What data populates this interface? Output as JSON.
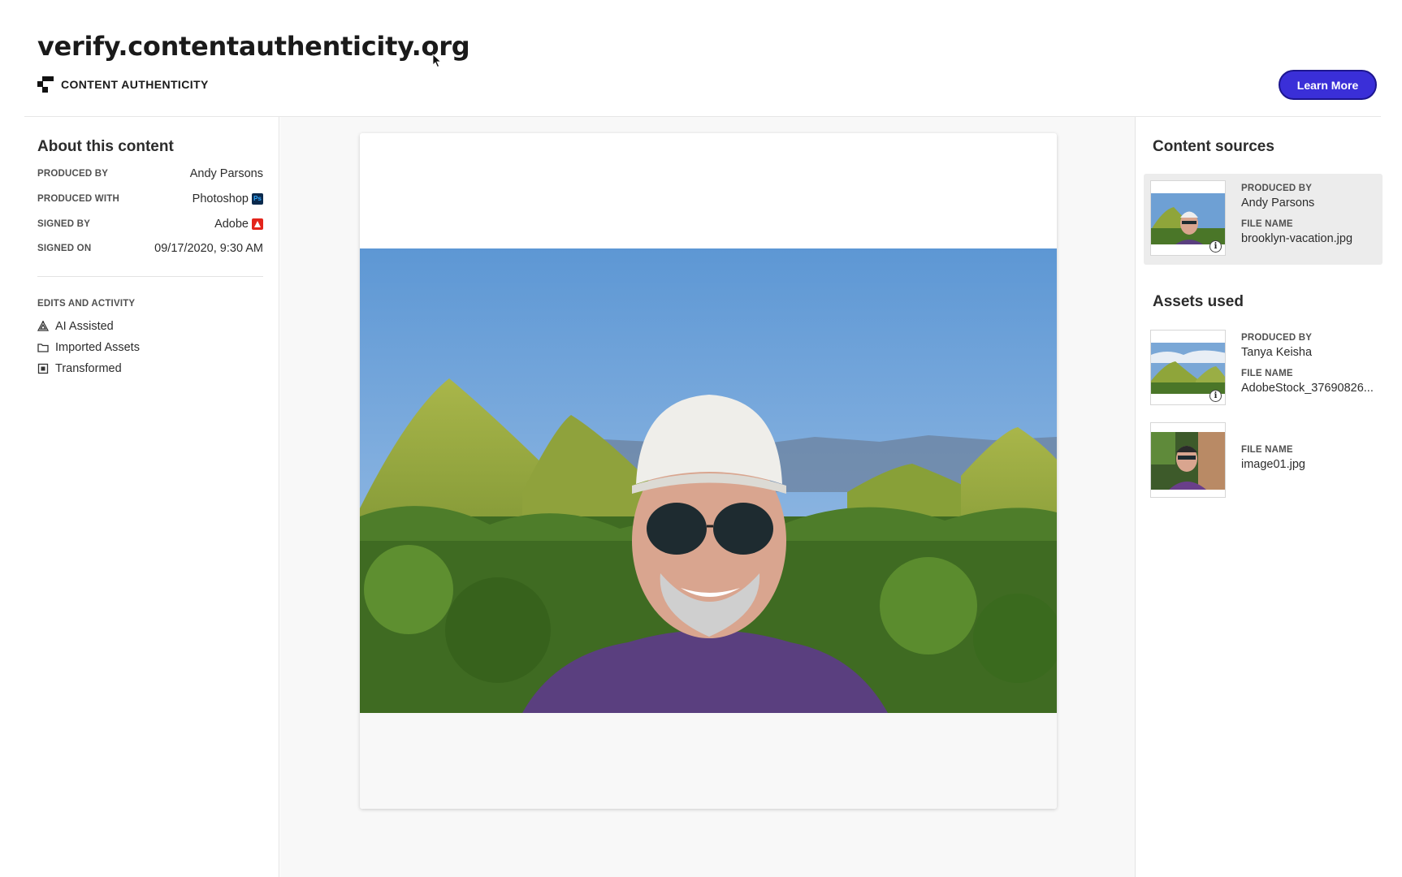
{
  "header": {
    "url": "verify.contentauthenticity.org",
    "brand": "CONTENT AUTHENTICITY",
    "learn_more": "Learn More"
  },
  "about": {
    "title": "About this content",
    "rows": [
      {
        "key": "PRODUCED BY",
        "value": "Andy Parsons"
      },
      {
        "key": "PRODUCED WITH",
        "value": "Photoshop",
        "badge": "Ps"
      },
      {
        "key": "SIGNED BY",
        "value": "Adobe"
      },
      {
        "key": "SIGNED ON",
        "value": "09/17/2020, 9:30 AM"
      }
    ],
    "edits_title": "EDITS AND ACTIVITY",
    "edits": [
      "AI Assisted",
      "Imported Assets",
      "Transformed"
    ]
  },
  "sources": {
    "title": "Content sources",
    "items": [
      {
        "produced_by_label": "PRODUCED BY",
        "produced_by": "Andy Parsons",
        "file_label": "FILE NAME",
        "file": "brooklyn-vacation.jpg"
      }
    ]
  },
  "assets": {
    "title": "Assets used",
    "items": [
      {
        "produced_by_label": "PRODUCED BY",
        "produced_by": "Tanya Keisha",
        "file_label": "FILE NAME",
        "file": "AdobeStock_37690826..."
      },
      {
        "file_label": "FILE NAME",
        "file": "image01.jpg"
      }
    ]
  },
  "colors": {
    "accent": "#3a2fd8",
    "sky": "#6aa1d8",
    "hills": "#8fa53a",
    "shirt": "#5a3f7f"
  }
}
